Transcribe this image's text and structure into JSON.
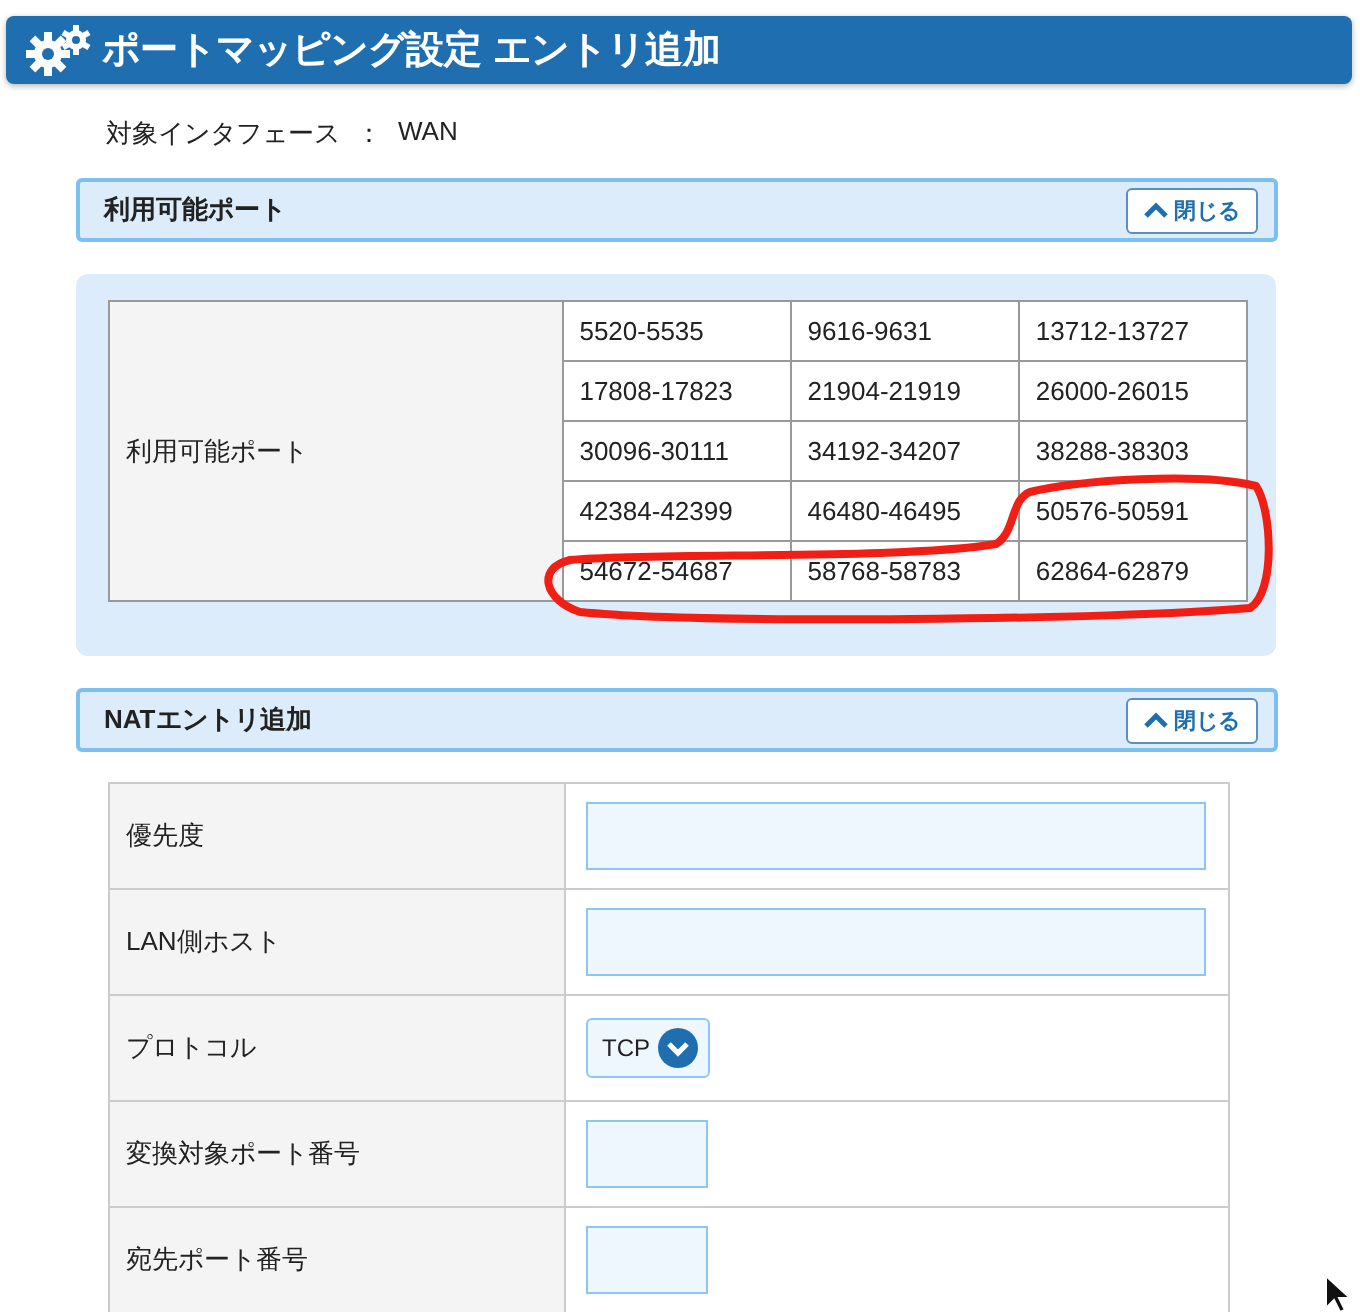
{
  "header": {
    "title": "ポートマッピング設定 エントリ追加"
  },
  "interface": {
    "label": "対象インタフェース",
    "separator": "：",
    "value": "WAN"
  },
  "ports_panel": {
    "title": "利用可能ポート",
    "close_button": "閉じる",
    "row_label": "利用可能ポート",
    "ranges": [
      [
        "5520-5535",
        "9616-9631",
        "13712-13727"
      ],
      [
        "17808-17823",
        "21904-21919",
        "26000-26015"
      ],
      [
        "30096-30111",
        "34192-34207",
        "38288-38303"
      ],
      [
        "42384-42399",
        "46480-46495",
        "50576-50591"
      ],
      [
        "54672-54687",
        "58768-58783",
        "62864-62879"
      ]
    ]
  },
  "nat_panel": {
    "title": "NATエントリ追加",
    "close_button": "閉じる",
    "rows": [
      {
        "label": "優先度",
        "kind": "wide"
      },
      {
        "label": "LAN側ホスト",
        "kind": "wide"
      },
      {
        "label": "プロトコル",
        "kind": "select",
        "value": "TCP"
      },
      {
        "label": "変換対象ポート番号",
        "kind": "narrow"
      },
      {
        "label": "宛先ポート番号",
        "kind": "narrow"
      }
    ]
  }
}
